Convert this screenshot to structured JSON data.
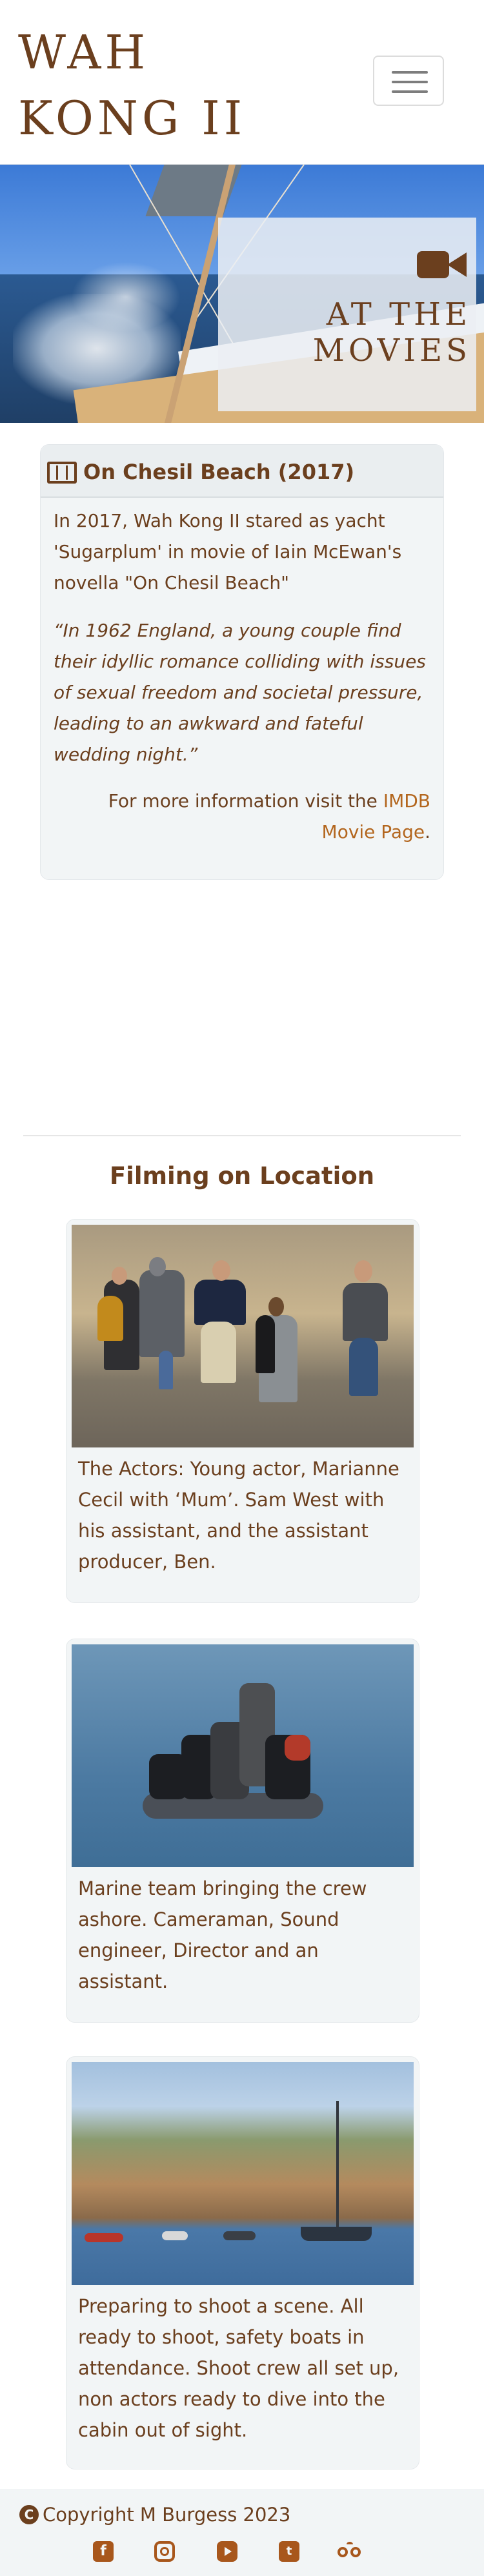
{
  "navbar": {
    "brand_line1": "WAH",
    "brand_line2": "KONG II"
  },
  "hero": {
    "icon": "video-camera-icon",
    "title_line1": "AT THE",
    "title_line2": "MOVIES"
  },
  "movie_card": {
    "icon": "film-icon",
    "title": "On Chesil Beach (2017)",
    "text": "In 2017, Wah Kong II stared as yacht 'Sugarplum' in movie of Iain McEwan's novella \"On Chesil Beach\"",
    "quote": "“In 1962 England, a young couple find their idyllic romance colliding with issues of sexual freedom and societal pressure, leading to an awkward and fateful wedding night.”",
    "more_prefix": "For more information visit the ",
    "more_link": "IMDB Movie Page",
    "more_suffix": "."
  },
  "filming": {
    "title": "Filming on Location",
    "photos": [
      {
        "caption": "The Actors: Young actor, Marianne Cecil with ‘Mum’. Sam West with his assistant, and the assistant producer, Ben."
      },
      {
        "caption": "Marine team bringing the crew ashore. Cameraman, Sound engineer, Director and an assistant."
      },
      {
        "caption": "Preparing to shoot a scene. All ready to shoot, safety boats in attendance. Shoot crew all set up, non actors ready to dive into the cabin out of sight."
      }
    ]
  },
  "footer": {
    "copyright": "Copyright M Burgess 2023",
    "icons": [
      "facebook-icon",
      "instagram-icon",
      "youtube-icon",
      "twitter-icon",
      "tripadvisor-icon"
    ]
  },
  "colors": {
    "brand_brown": "#6b3f1e",
    "link_orange": "#b3661e",
    "icon_orange": "#a8571c",
    "card_bg": "#f2f5f6"
  }
}
